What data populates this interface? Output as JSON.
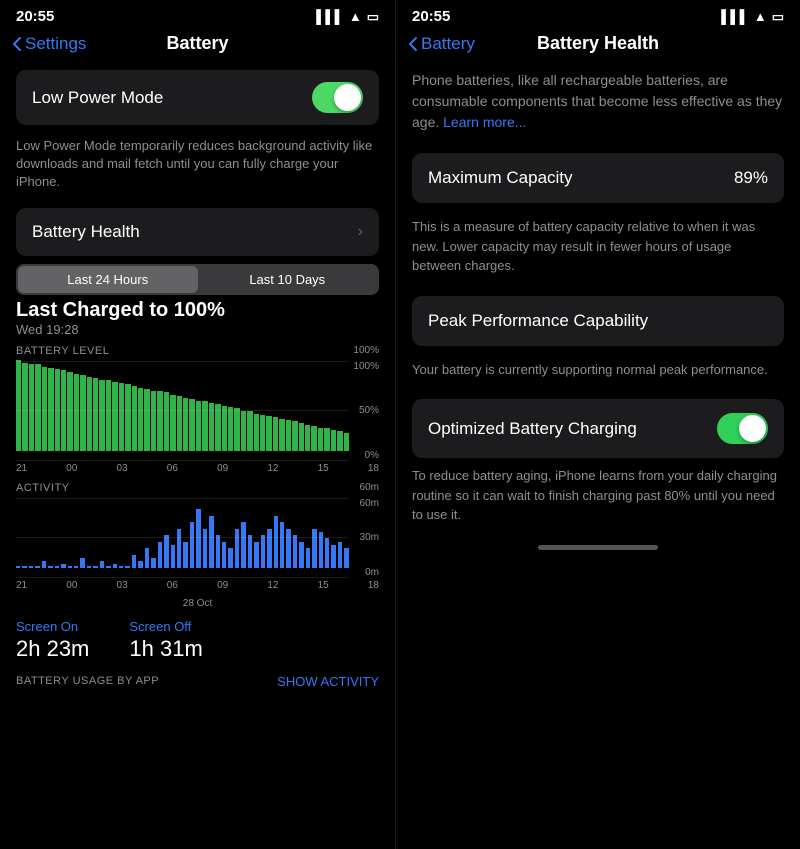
{
  "left": {
    "status_time": "20:55",
    "nav_back": "Settings",
    "nav_title": "Battery",
    "low_power_mode": {
      "label": "Low Power Mode",
      "toggle": "on"
    },
    "low_power_desc": "Low Power Mode temporarily reduces background activity like downloads and mail fetch until you can fully charge your iPhone.",
    "battery_health": {
      "label": "Battery Health",
      "chevron": "›"
    },
    "tabs": {
      "tab1": "Last 24 Hours",
      "tab2": "Last 10 Days",
      "active": 0
    },
    "last_charged": "Last Charged to 100%",
    "charge_date": "Wed 19:28",
    "battery_level_label": "BATTERY LEVEL",
    "activity_label": "ACTIVITY",
    "time_labels": [
      "21",
      "00",
      "03",
      "06",
      "09",
      "12",
      "15",
      "18"
    ],
    "activity_time_labels": [
      "21",
      "00",
      "03",
      "06",
      "09",
      "12",
      "15",
      "18"
    ],
    "date_label": "28 Oct",
    "screen_on_label": "Screen On",
    "screen_on_value": "2h 23m",
    "screen_off_label": "Screen Off",
    "screen_off_value": "1h 31m",
    "battery_usage_label": "BATTERY USAGE BY APP",
    "show_activity_label": "SHOW ACTIVITY",
    "y_labels": [
      "100%",
      "50%",
      "0%"
    ],
    "activity_y_labels": [
      "60m",
      "30m",
      "0m"
    ]
  },
  "right": {
    "status_time": "20:55",
    "nav_back": "Battery",
    "nav_title": "Battery Health",
    "intro_text": "Phone batteries, like all rechargeable batteries, are consumable components that become less effective as they age.",
    "learn_more": "Learn more...",
    "maximum_capacity": {
      "label": "Maximum Capacity",
      "value": "89%"
    },
    "capacity_desc": "This is a measure of battery capacity relative to when it was new. Lower capacity may result in fewer hours of usage between charges.",
    "peak_performance": {
      "label": "Peak Performance Capability",
      "desc": "Your battery is currently supporting normal peak performance."
    },
    "optimized_charging": {
      "label": "Optimized Battery Charging",
      "toggle": "on",
      "desc": "To reduce battery aging, iPhone learns from your daily charging routine so it can wait to finish charging past 80% until you need to use it."
    }
  }
}
